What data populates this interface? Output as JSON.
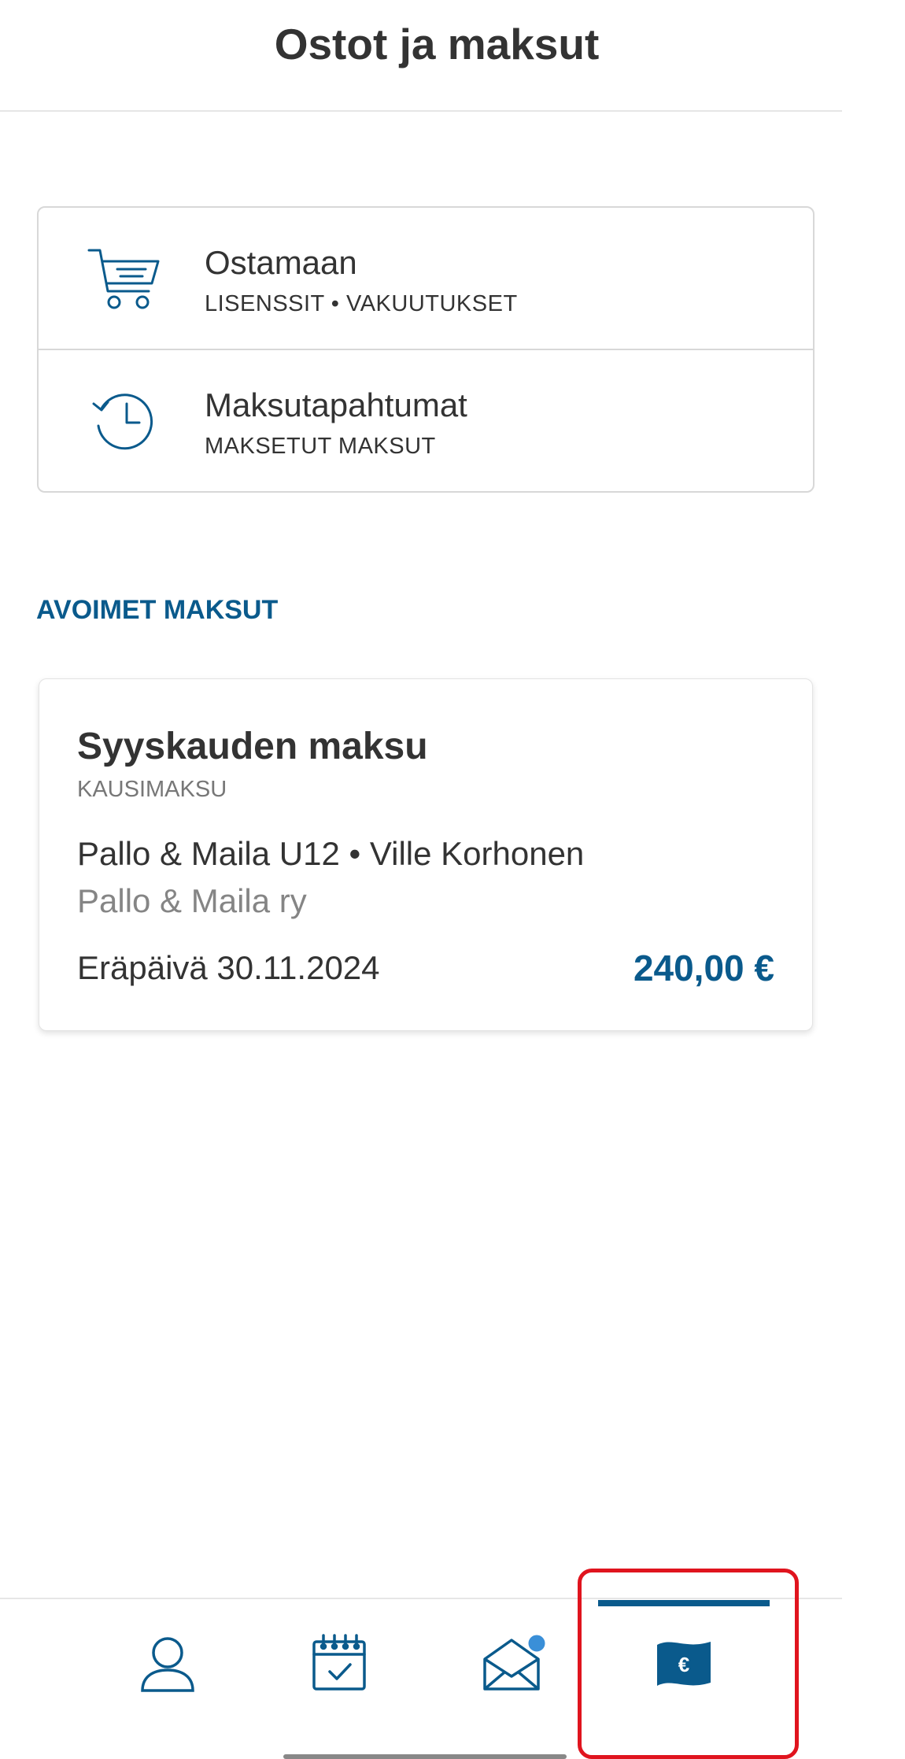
{
  "header": {
    "title": "Ostot ja maksut"
  },
  "menu": {
    "items": [
      {
        "icon": "cart-icon",
        "title": "Ostamaan",
        "subtitle": "LISENSSIT • VAKUUTUKSET"
      },
      {
        "icon": "history-icon",
        "title": "Maksutapahtumat",
        "subtitle": "MAKSETUT MAKSUT"
      }
    ]
  },
  "open_payments": {
    "section_title": "AVOIMET MAKSUT",
    "items": [
      {
        "title": "Syyskauden maksu",
        "type": "KAUSIMAKSU",
        "team_player": "Pallo & Maila U12 • Ville Korhonen",
        "club": "Pallo & Maila ry",
        "due": "Eräpäivä 30.11.2024",
        "amount": "240,00 €"
      }
    ]
  },
  "nav": {
    "items": [
      {
        "icon": "profile-icon",
        "active": false
      },
      {
        "icon": "calendar-icon",
        "active": false
      },
      {
        "icon": "messages-icon",
        "active": false,
        "badge": true
      },
      {
        "icon": "payments-icon",
        "active": true
      }
    ],
    "accent_color": "#0a5a8c",
    "badge_color": "#3a8fd8",
    "highlight_color": "#e0141e"
  }
}
